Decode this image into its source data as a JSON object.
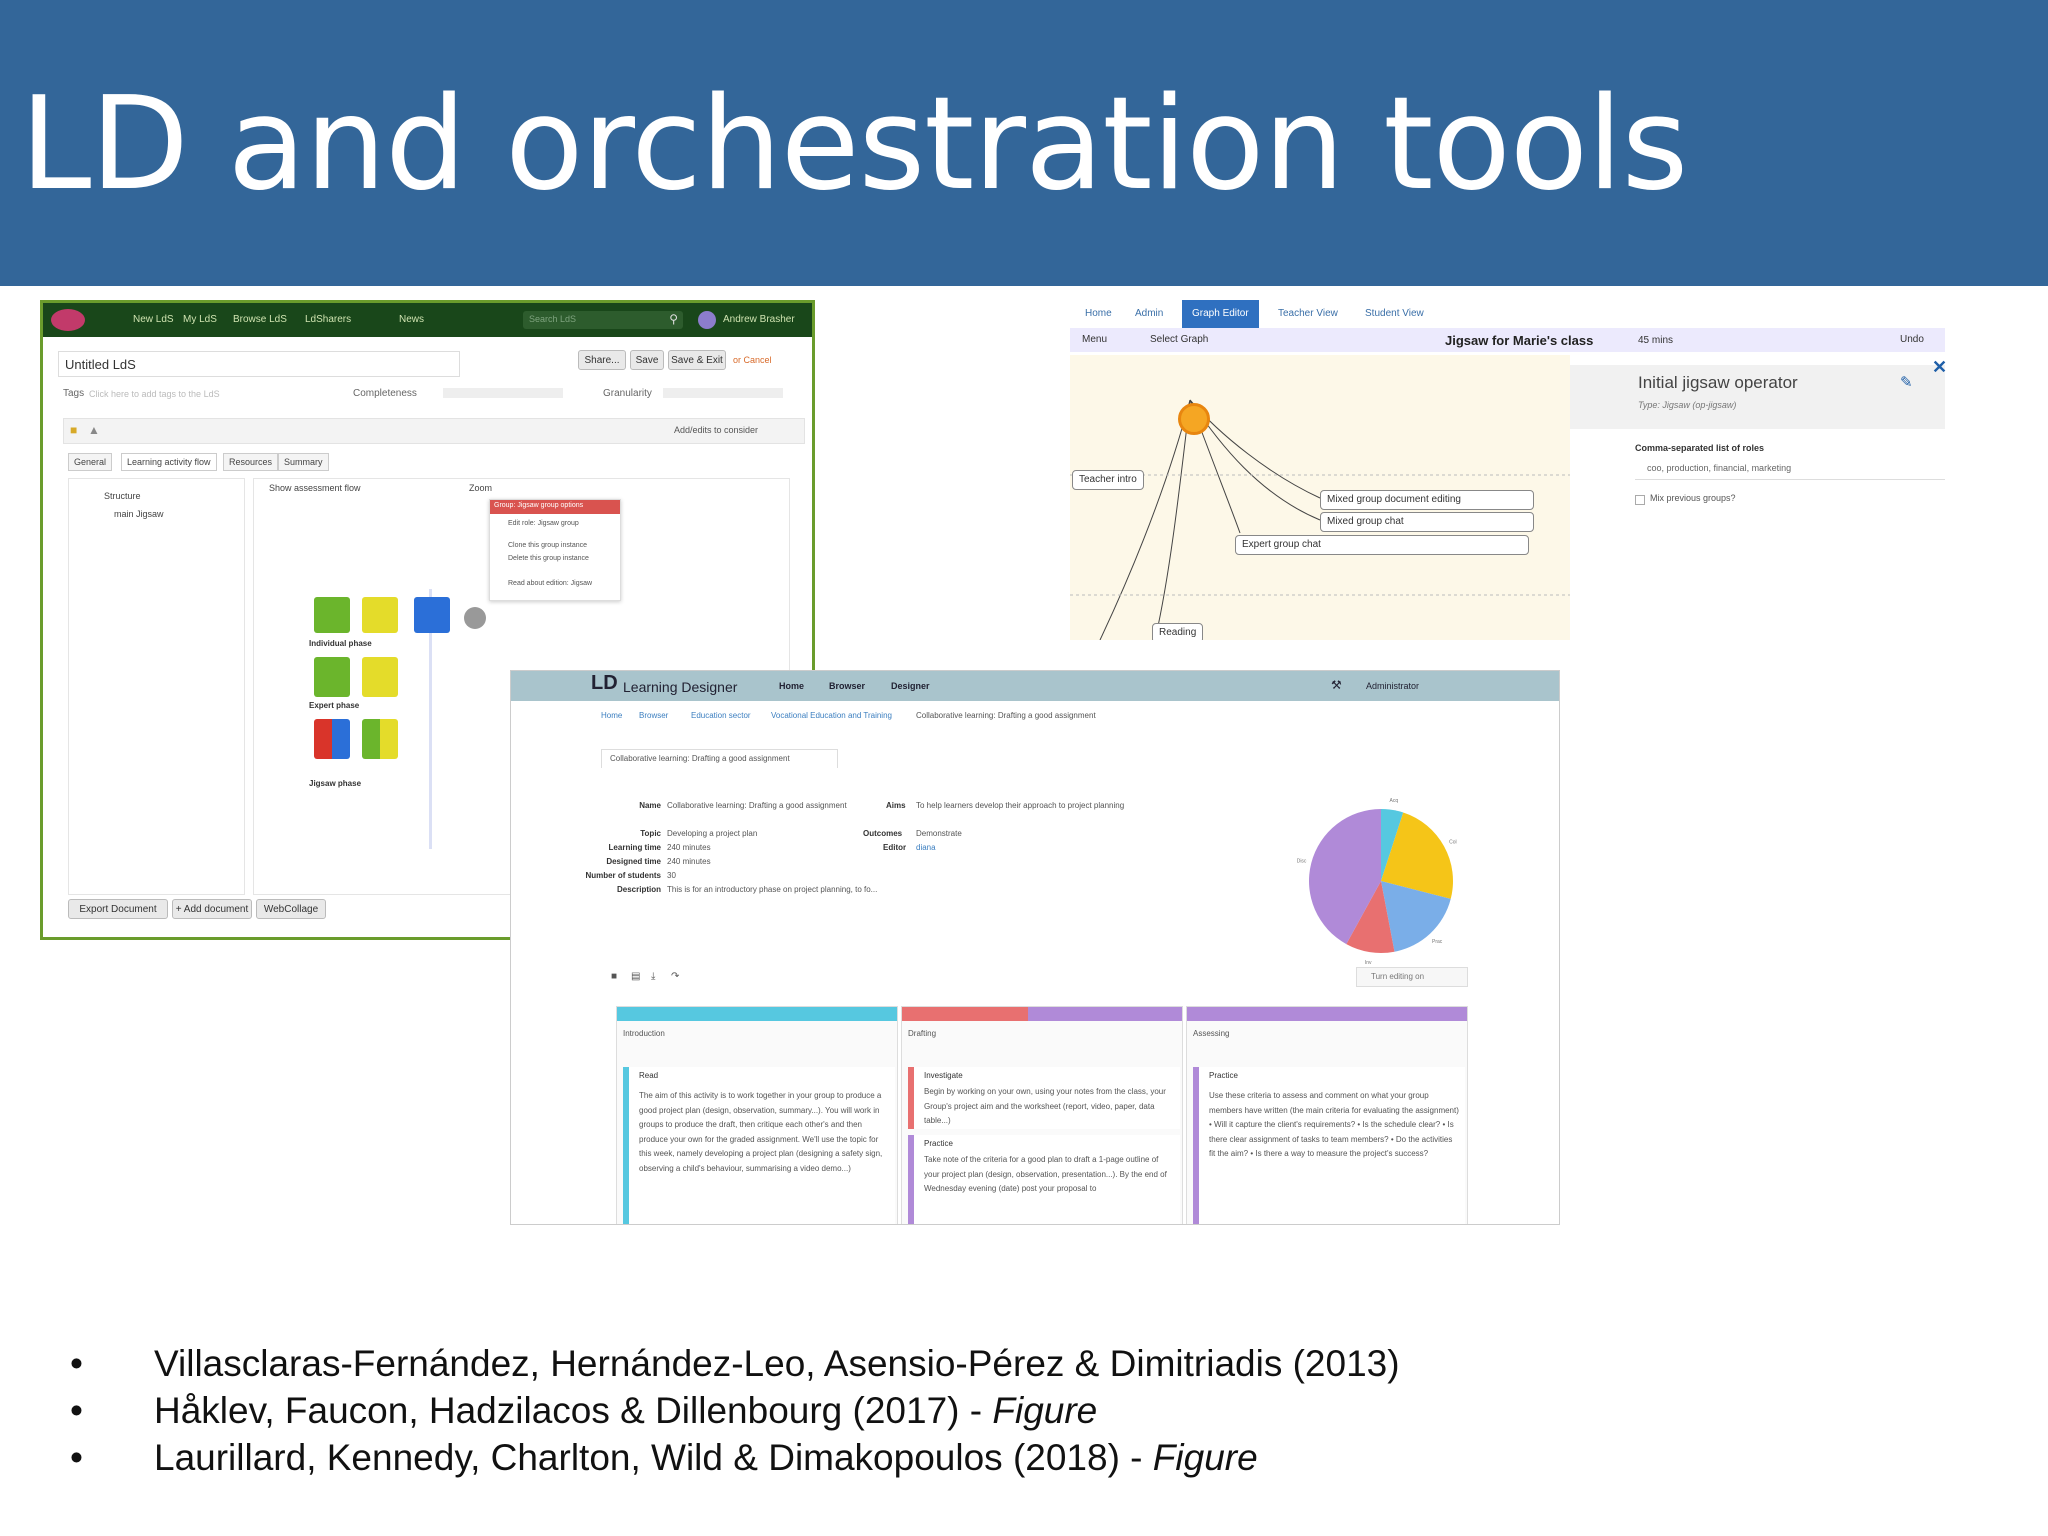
{
  "slide": {
    "title": "LD and orchestration tools"
  },
  "shot1": {
    "nav": [
      "New LdS",
      "My LdS",
      "Browse LdS",
      "LdSharers",
      "News"
    ],
    "search_placeholder": "Search LdS",
    "user": "Andrew Brasher",
    "doc_title": "Untitled LdS",
    "share_label": "Share...",
    "save_label": "Save",
    "save_exit_label": "Save & Exit",
    "cancel_label": "or Cancel",
    "tags_label": "Tags",
    "tags_hint": "Click here to add tags to the LdS",
    "completeness_label": "Completeness",
    "granularity_label": "Granularity",
    "add_ldlets": "Add/edits to consider",
    "tabs": [
      "General",
      "Learning activity flow",
      "Resources",
      "Summary"
    ],
    "tree": [
      "Structure",
      "main Jigsaw"
    ],
    "flow_label": "Show assessment flow",
    "zoom_label": "Zoom",
    "menu": [
      "Group: Jigsaw group options",
      "Edit role: Jigsaw group",
      "Clone this group instance",
      "Delete this group instance",
      "Read about edition: Jigsaw"
    ],
    "phases": [
      "Individual phase",
      "Expert phase",
      "Jigsaw phase"
    ],
    "bottom": [
      "Export Document",
      "+ Add document",
      "WebCollage"
    ]
  },
  "shot2": {
    "tabs": [
      "Home",
      "Admin",
      "Graph Editor",
      "Teacher View",
      "Student View"
    ],
    "menu_label": "Menu",
    "select_graph": "Select Graph",
    "class_title": "Jigsaw for Marie's class",
    "duration": "45 mins",
    "undo": "Undo",
    "nodes": [
      "Teacher intro",
      "Mixed group document editing",
      "Mixed group chat",
      "Expert group chat",
      "Reading"
    ],
    "panel_title": "Initial jigsaw operator",
    "panel_type": "Type: Jigsaw (op-jigsaw)",
    "roles_label": "Comma-separated list of roles",
    "roles_value": "coo, production, financial, marketing",
    "mix_label": "Mix previous groups?",
    "close_icon_color": "#1f5fa8"
  },
  "shot3": {
    "brand": "Learning Designer",
    "nav": [
      "Home",
      "Browser",
      "Designer"
    ],
    "admin": "Administrator",
    "breadcrumb": [
      "Home",
      "Browser",
      "Education sector",
      "Vocational Education and Training",
      "Collaborative learning: Drafting a good assignment"
    ],
    "tab": "Collaborative learning: Drafting a good assignment",
    "fields": [
      {
        "label": "Name",
        "value": "Collaborative learning: Drafting a good assignment"
      },
      {
        "label": "Topic",
        "value": "Developing a project plan"
      },
      {
        "label": "Learning time",
        "value": "240 minutes"
      },
      {
        "label": "Designed time",
        "value": "240 minutes"
      },
      {
        "label": "Number of students",
        "value": "30"
      },
      {
        "label": "Description",
        "value": "This is for an introductory phase on project planning, to fo..."
      }
    ],
    "aims_label": "Aims",
    "aims_value": "To help learners develop their approach to project planning",
    "outcomes_label": "Outcomes",
    "outcomes_value": "Demonstrate",
    "editor_label": "Editor",
    "editor_value": "diana",
    "turn_editing": "Turn editing on",
    "columns": [
      {
        "title": "Introduction",
        "color": "#56c8e0",
        "cards": [
          {
            "title": "Read",
            "text": "The aim of this activity is to work together in your group to produce a good project plan (design, observation, summary...). You will work in groups to produce the draft, then critique each other's and then produce your own for the graded assignment. We'll use the topic for this week, namely developing a project plan (designing a safety sign, observing a child's behaviour, summarising a video demo...)"
          }
        ]
      },
      {
        "title": "Drafting",
        "color": "#e87070",
        "cards": [
          {
            "title": "Investigate",
            "text": "Begin by working on your own, using your notes from the class, your Group's project aim and the worksheet (report, video, paper, data table...)"
          },
          {
            "title": "Practice",
            "text": "Take note of the criteria for a good plan to draft a 1-page outline of your project plan (design, observation, presentation...). By the end of Wednesday evening (date) post your proposal to"
          }
        ]
      },
      {
        "title": "Assessing",
        "color": "#b08ad8",
        "cards": [
          {
            "title": "Practice",
            "text": "Use these criteria to assess and comment on what your group members have written (the main criteria for evaluating the assignment) • Will it capture the client's requirements? • Is the schedule clear? • Is there clear assignment of tasks to team members? • Do the activities fit the aim? • Is there a way to measure the project's success?"
          }
        ]
      }
    ],
    "pie": [
      {
        "label": "Acq",
        "value": 5,
        "color": "#56c8e0"
      },
      {
        "label": "Col",
        "value": 24,
        "color": "#f5c518"
      },
      {
        "label": "Prac",
        "value": 18,
        "color": "#7aaee8"
      },
      {
        "label": "Inv",
        "value": 11,
        "color": "#e87070"
      },
      {
        "label": "Disc",
        "value": 42,
        "color": "#b08ad8"
      }
    ]
  },
  "references": [
    {
      "text": "Villasclaras-Fernández, Hernández-Leo, Asensio-Pérez & Dimitriadis (2013)",
      "suffix": ""
    },
    {
      "text": "Håklev, Faucon, Hadzilacos & Dillenbourg (2017) - ",
      "suffix": "Figure"
    },
    {
      "text": "Laurillard, Kennedy, Charlton, Wild & Dimakopoulos (2018) - ",
      "suffix": "Figure"
    }
  ],
  "bullet": "•"
}
